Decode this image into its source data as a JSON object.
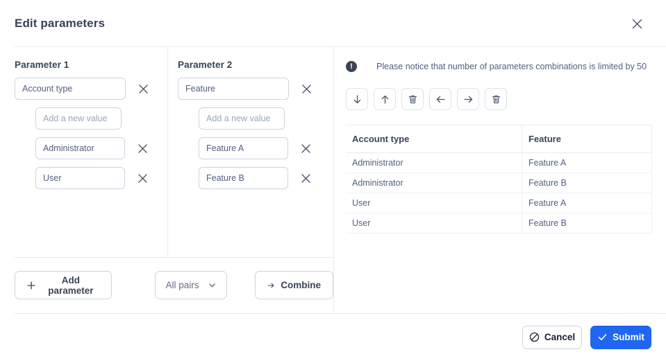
{
  "dialog": {
    "title": "Edit parameters",
    "close_icon": "close-icon"
  },
  "parameters": [
    {
      "label": "Parameter 1",
      "name_value": "Account type",
      "add_value_placeholder": "Add a new value",
      "add_value_current": "",
      "values": [
        "Administrator",
        "User"
      ]
    },
    {
      "label": "Parameter 2",
      "name_value": "Feature",
      "add_value_placeholder": "Add a new value",
      "add_value_current": "",
      "values": [
        "Feature A",
        "Feature B"
      ]
    }
  ],
  "left_actions": {
    "add_parameter_label": "Add parameter",
    "add_parameter_icon": "plus-icon",
    "mode_selected": "All pairs",
    "mode_chevron_icon": "chevron-down-icon",
    "combine_label": "Combine",
    "combine_icon": "arrow-right-icon"
  },
  "notice": {
    "icon": "exclamation-circle-icon",
    "text": "Please notice that number of parameters combinations is limited by 50"
  },
  "toolbar": {
    "buttons": [
      {
        "name": "move-down-button",
        "icon": "arrow-down-icon"
      },
      {
        "name": "move-up-button",
        "icon": "arrow-up-icon"
      },
      {
        "name": "delete-row-button",
        "icon": "trash-icon"
      },
      {
        "name": "move-left-button",
        "icon": "arrow-left-icon"
      },
      {
        "name": "move-right-button",
        "icon": "arrow-right-icon"
      },
      {
        "name": "delete-column-button",
        "icon": "trash-icon"
      }
    ]
  },
  "result_table": {
    "columns": [
      "Account type",
      "Feature"
    ],
    "rows": [
      [
        "Administrator",
        "Feature A"
      ],
      [
        "Administrator",
        "Feature B"
      ],
      [
        "User",
        "Feature A"
      ],
      [
        "User",
        "Feature B"
      ]
    ]
  },
  "footer": {
    "cancel_label": "Cancel",
    "cancel_icon": "no-entry-icon",
    "submit_label": "Submit",
    "submit_icon": "check-icon",
    "submit_color": "#1f66f0"
  }
}
